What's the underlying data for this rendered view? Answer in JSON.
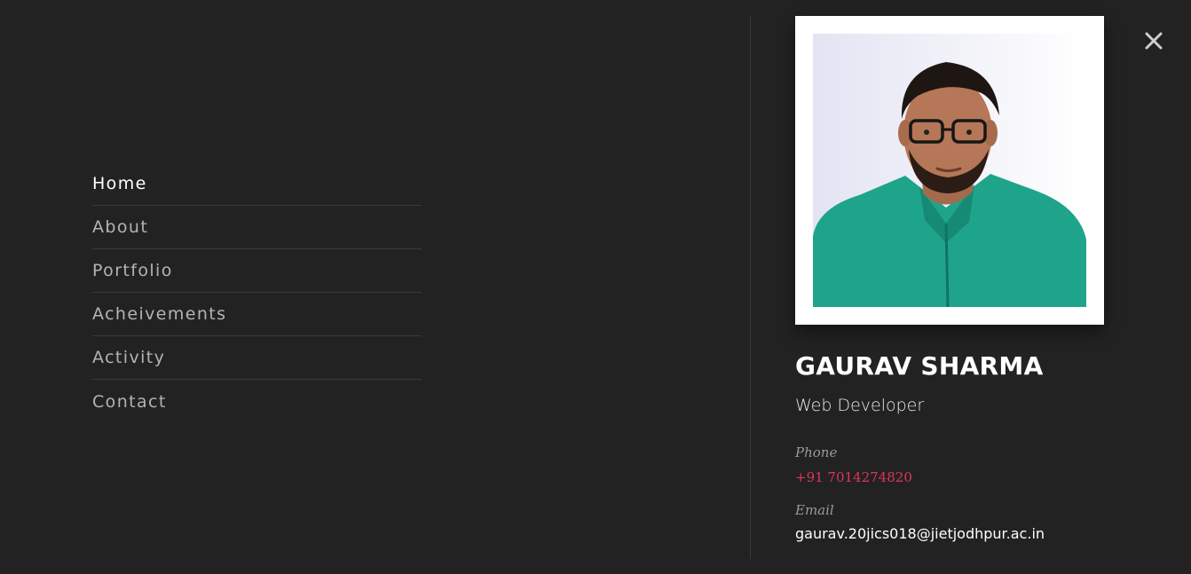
{
  "nav": {
    "items": [
      {
        "label": "Home",
        "active": true
      },
      {
        "label": "About"
      },
      {
        "label": "Portfolio"
      },
      {
        "label": "Acheivements"
      },
      {
        "label": "Activity"
      },
      {
        "label": "Contact"
      }
    ],
    "close_icon": "close-icon"
  },
  "profile": {
    "photo_icon": "profile-photo",
    "name": "GAURAV SHARMA",
    "role": "Web Developer",
    "phone_label": "Phone",
    "phone": "+91 7014274820",
    "email_label": "Email",
    "email": "gaurav.20jics018@jietjodhpur.ac.in"
  },
  "colors": {
    "background": "#222222",
    "accent": "#e0345f",
    "text": "#ffffff",
    "muted": "#b3b3b3"
  }
}
